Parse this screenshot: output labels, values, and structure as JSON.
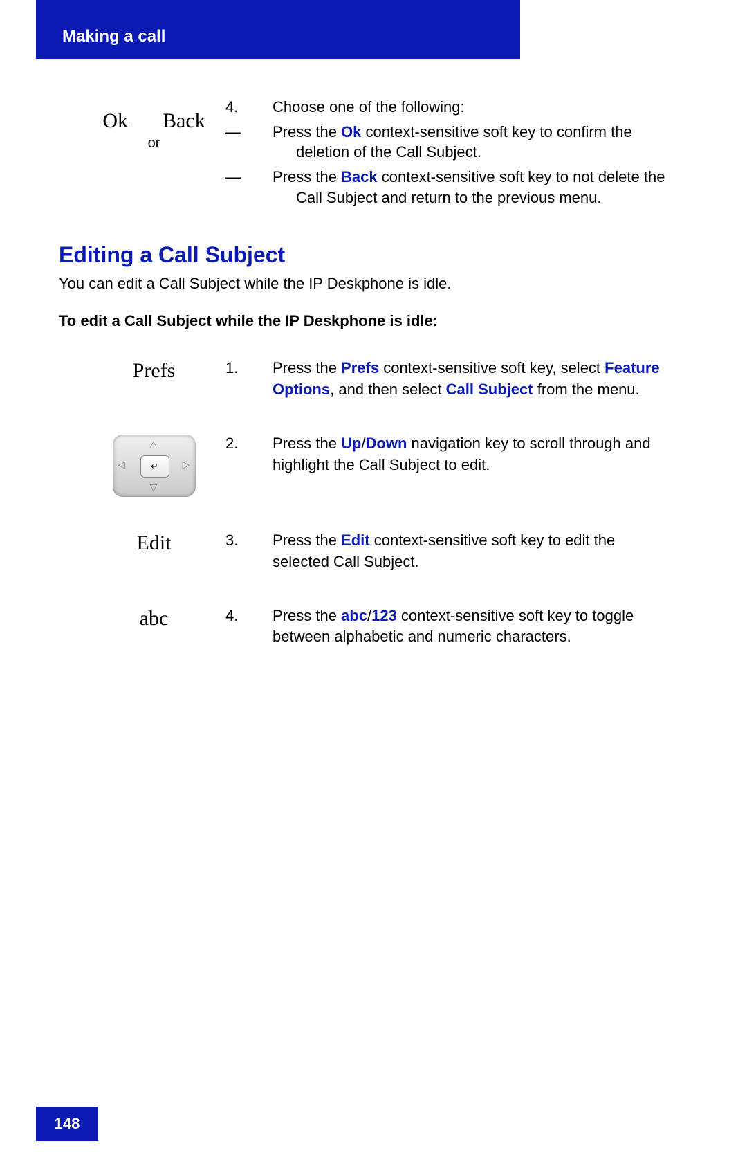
{
  "header": {
    "chapter": "Making a call"
  },
  "top_step": {
    "keys": {
      "ok": "Ok",
      "or": "or",
      "back": "Back"
    },
    "num": "4",
    "lead": "Choose one of the following:",
    "bullets": [
      {
        "pre": "Press the ",
        "k": "Ok",
        "post": " context-sensitive soft key to confirm the deletion of the Call Subject."
      },
      {
        "pre": "Press the ",
        "k": "Back",
        "post": " context-sensitive soft key to not delete the Call Subject and return to the previous menu."
      }
    ]
  },
  "section": {
    "heading": "Editing a Call Subject",
    "intro": "You can edit a Call Subject while the IP Deskphone is idle.",
    "subhead": "To edit a Call Subject while the IP Deskphone is idle:"
  },
  "steps": [
    {
      "key_label": "Prefs",
      "num": "1",
      "segments": [
        {
          "t": "Press the "
        },
        {
          "k": "Prefs"
        },
        {
          "t": " context-sensitive soft key, select "
        },
        {
          "k": "Feature Options"
        },
        {
          "t": ", and then select "
        },
        {
          "k": "Call Subject"
        },
        {
          "t": " from the menu."
        }
      ]
    },
    {
      "key_label": "",
      "show_navkey": true,
      "num": "2",
      "segments": [
        {
          "t": "Press the "
        },
        {
          "k": "Up"
        },
        {
          "t": "/"
        },
        {
          "k": "Down"
        },
        {
          "t": " navigation key to scroll through and highlight the Call Subject to edit."
        }
      ]
    },
    {
      "key_label": "Edit",
      "num": "3",
      "segments": [
        {
          "t": "Press the "
        },
        {
          "k": "Edit"
        },
        {
          "t": " context-sensitive soft key to edit the selected Call Subject."
        }
      ]
    },
    {
      "key_label": "abc",
      "num": "4",
      "segments": [
        {
          "t": "Press the "
        },
        {
          "k": "abc"
        },
        {
          "t": "/"
        },
        {
          "k": "123"
        },
        {
          "t": " context-sensitive soft key to toggle between alphabetic and numeric characters."
        }
      ]
    }
  ],
  "page_number": "148"
}
